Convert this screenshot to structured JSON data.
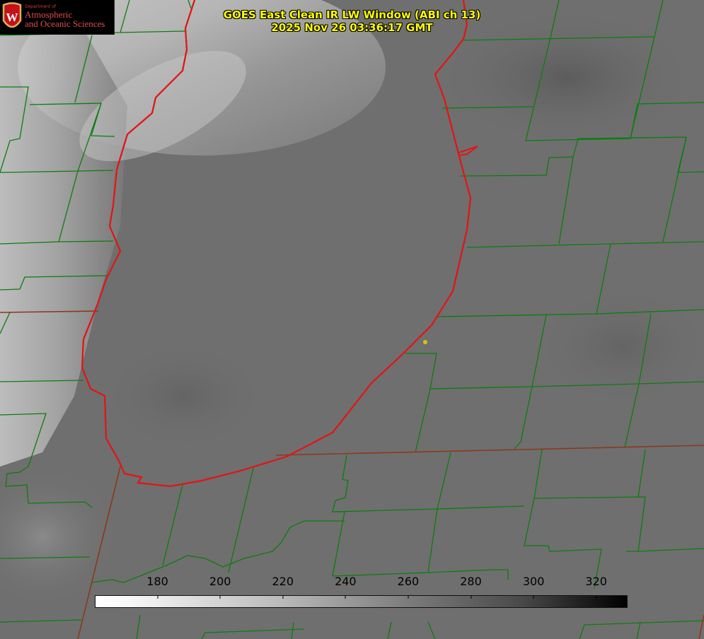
{
  "header": {
    "title": "GOES East Clean IR LW Window (ABI ch 13)",
    "timestamp": "2025 Nov 26 03:36:17 GMT"
  },
  "logo": {
    "department_text": "Department of",
    "line1": "Atmospheric",
    "line2": "and Oceanic Sciences",
    "crest_letter": "W"
  },
  "colorbar": {
    "min": 160,
    "max": 330,
    "ticks": [
      "180",
      "200",
      "220",
      "240",
      "260",
      "280",
      "300",
      "320"
    ]
  },
  "colors": {
    "background_gray": "#6f6f6f",
    "lake_outline": "#e41515",
    "boundary_green": "#0c7e0c",
    "state_boundary": "#8b3a1a",
    "title_yellow": "#ffff00",
    "marker_yellow": "#d8c600"
  }
}
